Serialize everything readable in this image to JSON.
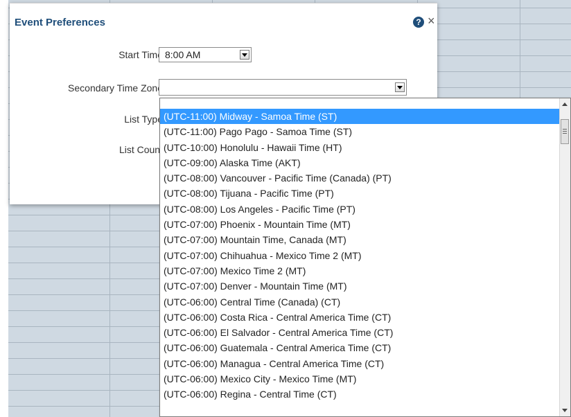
{
  "dialog": {
    "title": "Event Preferences",
    "help_symbol": "?",
    "close_symbol": "×",
    "fields": {
      "start_time": {
        "label": "Start Time",
        "value": "8:00 AM"
      },
      "secondary_time_zone": {
        "label": "Secondary Time Zone",
        "value": ""
      },
      "list_type": {
        "label": "List Type"
      },
      "list_count": {
        "label": "List Count"
      }
    }
  },
  "timezone_options": [
    "(UTC-11:00) Midway - Samoa Time (ST)",
    "(UTC-11:00) Pago Pago - Samoa Time (ST)",
    "(UTC-10:00) Honolulu - Hawaii Time (HT)",
    "(UTC-09:00) Alaska Time (AKT)",
    "(UTC-08:00) Vancouver - Pacific Time (Canada) (PT)",
    "(UTC-08:00) Tijuana - Pacific Time (PT)",
    "(UTC-08:00) Los Angeles - Pacific Time (PT)",
    "(UTC-07:00) Phoenix - Mountain Time (MT)",
    "(UTC-07:00) Mountain Time, Canada (MT)",
    "(UTC-07:00) Chihuahua - Mexico Time 2 (MT)",
    "(UTC-07:00) Mexico Time 2 (MT)",
    "(UTC-07:00) Denver - Mountain Time (MT)",
    "(UTC-06:00) Central Time (Canada) (CT)",
    "(UTC-06:00) Costa Rica - Central America Time (CT)",
    "(UTC-06:00) El Salvador - Central America Time (CT)",
    "(UTC-06:00) Guatemala - Central America Time (CT)",
    "(UTC-06:00) Managua - Central America Time (CT)",
    "(UTC-06:00) Mexico City - Mexico Time (MT)",
    "(UTC-06:00) Regina - Central Time (CT)"
  ],
  "highlighted_index": 0,
  "colors": {
    "title": "#1f4e7a",
    "highlight": "#3399ff",
    "calendar_grid": "#cfd9e2"
  }
}
